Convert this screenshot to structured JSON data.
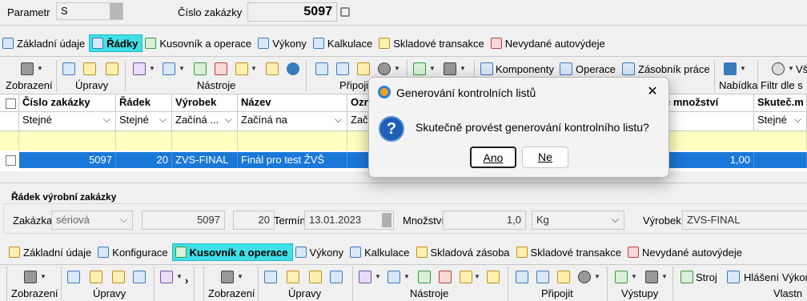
{
  "header": {
    "parametr_label": "Parametr",
    "parametr_value": "S",
    "cislo_zakazky_label": "Číslo zakázky",
    "cislo_zakazky_value": "5097"
  },
  "top_tabs": [
    {
      "label": "Základní údaje",
      "icon": "table-icon"
    },
    {
      "label": "Řádky",
      "icon": "rows-icon",
      "active": true
    },
    {
      "label": "Kusovník a operace",
      "icon": "bom-icon"
    },
    {
      "label": "Výkony",
      "icon": "performance-icon"
    },
    {
      "label": "Kalkulace",
      "icon": "calculation-icon"
    },
    {
      "label": "Skladové transakce",
      "icon": "warehouse-icon"
    },
    {
      "label": "Nevydané autovýdeje",
      "icon": "document-icon"
    }
  ],
  "toolbar": {
    "zobrazeni": "Zobrazení",
    "upravy": "Úpravy",
    "nastroje": "Nástroje",
    "pripojit": "Připoji",
    "komponenty": "Komponenty",
    "operace": "Operace",
    "zasobnik_prace": "Zásobník práce",
    "nabidka": "Nabídka",
    "filtr": "Filtr dle s",
    "vs": "Vš"
  },
  "grid": {
    "columns": [
      "Číslo zakázky",
      "Řádek",
      "Výrobek",
      "Název",
      "Ozn",
      "é množství",
      "Skuteč.m"
    ],
    "filters": [
      "Stejné",
      "Stejné",
      "Začíná ...",
      "Začíná na",
      "Zač",
      "",
      "Stejné"
    ],
    "row": {
      "cislo": "5097",
      "radek": "20",
      "vyrobek": "ZVS-FINAL",
      "nazev": "Finál pro test ŽVŠ",
      "mnozstvi": "1,00"
    }
  },
  "detail": {
    "section_title": "Řádek výrobní zakázky",
    "zakazka_label": "Zakázka",
    "zakazka_type": "sériová",
    "zakazka_number": "5097",
    "radek_value": "20",
    "termin_label": "Termín",
    "termin_value": "13.01.2023",
    "mnozstvi_label": "Množství",
    "mnozstvi_value": "1,0",
    "unit_value": "Kg",
    "vyrobek_label": "Výrobek",
    "vyrobek_value": "ZVS-FINAL"
  },
  "bottom_tabs": [
    {
      "label": "Základní údaje",
      "icon": "edit-icon"
    },
    {
      "label": "Konfigurace",
      "icon": "config-icon"
    },
    {
      "label": "Kusovník a operace",
      "icon": "bom-icon",
      "active": true
    },
    {
      "label": "Výkony",
      "icon": "performance-icon"
    },
    {
      "label": "Kalkulace",
      "icon": "calculation-icon"
    },
    {
      "label": "Skladová zásoba",
      "icon": "stock-icon"
    },
    {
      "label": "Skladové transakce",
      "icon": "warehouse-icon"
    },
    {
      "label": "Nevydané autovýdeje",
      "icon": "document-icon"
    }
  ],
  "bottom_toolbar": {
    "zobrazeni1": "Zobrazení",
    "upravy1": "Úpravy",
    "zobrazeni2": "Zobrazení",
    "upravy2": "Úpravy",
    "nastroje": "Nástroje",
    "pripojit": "Připojit",
    "vystupy": "Výstupy",
    "stroj": "Stroj",
    "hlaseni": "Hlášení Výkon",
    "vlastn": "Vlastn"
  },
  "dialog": {
    "title": "Generování kontrolních listů",
    "message": "Skutečně provést generování kontrolního listu?",
    "yes": "Ano",
    "no": "Ne",
    "icon": "question-icon",
    "close_glyph": "✕"
  },
  "colors": {
    "active_tab": "#3fe0e8",
    "selected_row": "#1a78d8",
    "filter_row": "#ffffc0"
  }
}
